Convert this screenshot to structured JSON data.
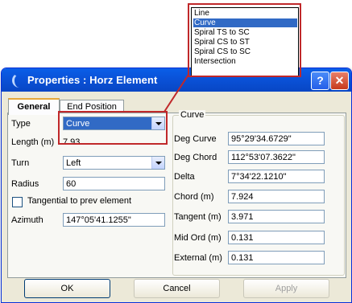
{
  "dropdown": {
    "options": [
      "Line",
      "Curve",
      "Spiral TS to SC",
      "Spiral CS to ST",
      "Spiral CS to SC",
      "Intersection"
    ],
    "selected_index": 1
  },
  "dialog": {
    "title": "Properties : Horz Element",
    "help_glyph": "?",
    "close_glyph": "✕",
    "tabs": [
      "General",
      "End Position"
    ]
  },
  "general": {
    "type_label": "Type",
    "type_value": "Curve",
    "length_label": "Length (m)",
    "length_value": "7.93",
    "turn_label": "Turn",
    "turn_value": "Left",
    "radius_label": "Radius",
    "radius_value": "60",
    "tangential_label": "Tangential to prev element",
    "tangential_checked": false,
    "azimuth_label": "Azimuth",
    "azimuth_value": "147°05'41.1255\""
  },
  "curve": {
    "group_title": "Curve",
    "fields": [
      {
        "label": "Deg Curve",
        "value": "95°29'34.6729\""
      },
      {
        "label": "Deg Chord",
        "value": "112°53'07.3622\""
      },
      {
        "label": "Delta",
        "value": "7°34'22.1210\""
      },
      {
        "label": "Chord (m)",
        "value": "7.924"
      },
      {
        "label": "Tangent (m)",
        "value": "3.971"
      },
      {
        "label": "Mid Ord (m)",
        "value": "0.131"
      },
      {
        "label": "External (m)",
        "value": "0.131"
      }
    ]
  },
  "buttons": {
    "ok": "OK",
    "cancel": "Cancel",
    "apply": "Apply"
  }
}
